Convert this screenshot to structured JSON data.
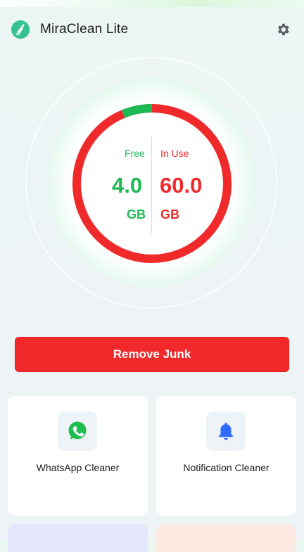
{
  "app": {
    "title": "MiraClean Lite",
    "logo_icon": "broom-icon",
    "settings_icon": "gear-icon"
  },
  "storage": {
    "free_label": "Free",
    "free_value": "4.0",
    "free_unit": "GB",
    "inuse_label": "In Use",
    "inuse_value": "60.0",
    "inuse_unit": "GB",
    "free_fraction": 0.0625,
    "colors": {
      "free": "#1db954",
      "in_use": "#f02a2b"
    }
  },
  "actions": {
    "remove_junk_label": "Remove Junk"
  },
  "cards": [
    {
      "label": "WhatsApp Cleaner",
      "icon": "whatsapp-icon"
    },
    {
      "label": "Notification Cleaner",
      "icon": "bell-icon"
    }
  ],
  "colors": {
    "accent_red": "#f1292b",
    "accent_green": "#1db954",
    "bell_blue": "#2f6bff"
  }
}
